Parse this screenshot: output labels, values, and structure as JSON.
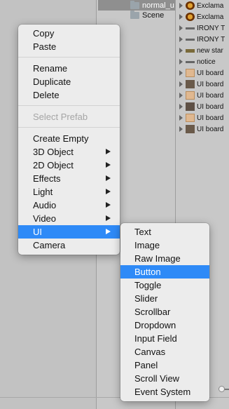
{
  "project_panel": {
    "folders": [
      {
        "label": "normal_u",
        "selected": true
      },
      {
        "label": "Scene",
        "selected": false
      }
    ]
  },
  "assets_panel": {
    "items": [
      {
        "label": "Exclama",
        "icon": "exclamation-thumb-icon"
      },
      {
        "label": "Exclama",
        "icon": "exclamation-thumb-icon"
      },
      {
        "label": "IRONY T",
        "icon": "line-thumb-icon"
      },
      {
        "label": "IRONY T",
        "icon": "line-thumb-icon"
      },
      {
        "label": "new star",
        "icon": "bar-thumb-icon"
      },
      {
        "label": "notice",
        "icon": "notice-thumb-icon"
      },
      {
        "label": "UI board",
        "icon": "board-thumb-icon"
      },
      {
        "label": "UI board",
        "icon": "board-thumb-icon"
      },
      {
        "label": "UI board",
        "icon": "board-thumb-icon"
      },
      {
        "label": "UI board",
        "icon": "board-thumb-icon"
      },
      {
        "label": "UI board",
        "icon": "board-thumb-icon"
      },
      {
        "label": "UI board",
        "icon": "board-thumb-icon"
      }
    ]
  },
  "context_menu": {
    "copy": "Copy",
    "paste": "Paste",
    "rename": "Rename",
    "duplicate": "Duplicate",
    "delete": "Delete",
    "select_prefab": "Select Prefab",
    "create_empty": "Create Empty",
    "object_3d": "3D Object",
    "object_2d": "2D Object",
    "effects": "Effects",
    "light": "Light",
    "audio": "Audio",
    "video": "Video",
    "ui": "UI",
    "camera": "Camera",
    "highlighted": "UI"
  },
  "ui_submenu": {
    "items": [
      "Text",
      "Image",
      "Raw Image",
      "Button",
      "Toggle",
      "Slider",
      "Scrollbar",
      "Dropdown",
      "Input Field",
      "Canvas",
      "Panel",
      "Scroll View",
      "Event System"
    ],
    "highlighted": "Button"
  },
  "colors": {
    "highlight": "#2e8af7",
    "menu_bg": "#ececec",
    "disabled_text": "#a5a5a5"
  }
}
